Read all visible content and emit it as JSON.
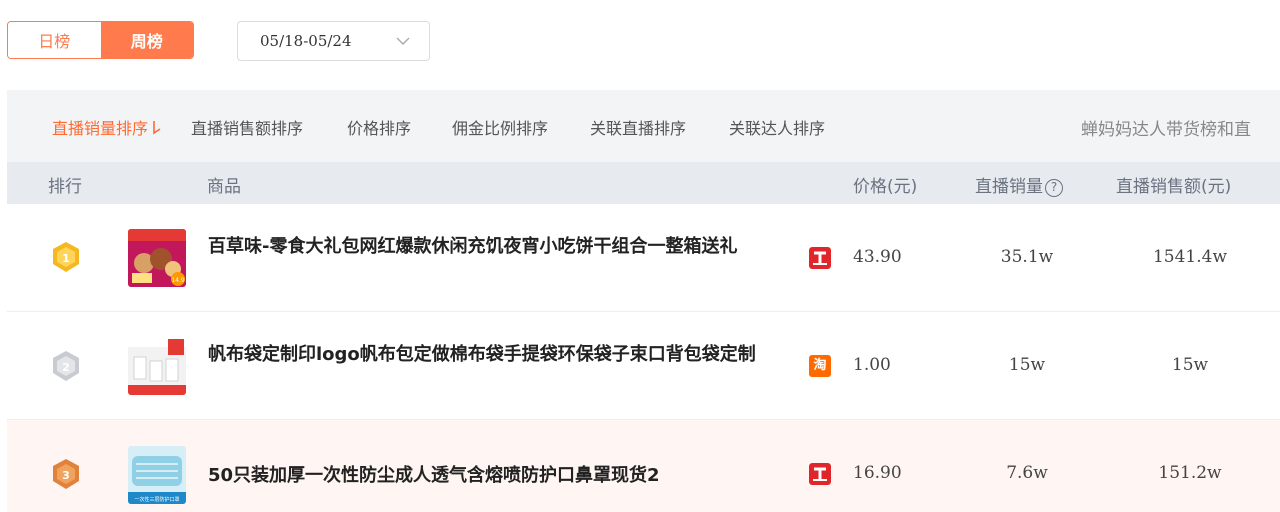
{
  "toggle": {
    "daily": "日榜",
    "weekly": "周榜"
  },
  "date_range": "05/18-05/24",
  "sort_options": [
    "直播销量排序",
    "直播销售额排序",
    "价格排序",
    "佣金比例排序",
    "关联直播排序",
    "关联达人排序"
  ],
  "right_title": "蝉妈妈达人带货榜和直",
  "columns": {
    "rank": "排行",
    "product": "商品",
    "price": "价格(元)",
    "sales": "直播销量",
    "amount": "直播销售额(元)"
  },
  "rows": [
    {
      "rank": "1",
      "name": "百草味-零食大礼包网红爆款休闲充饥夜宵小吃饼干组合一整箱送礼",
      "platform": "tmall",
      "price": "43.90",
      "sales": "35.1w",
      "amount": "1541.4w"
    },
    {
      "rank": "2",
      "name": "帆布袋定制印logo帆布包定做棉布袋手提袋环保袋子束口背包袋定制",
      "platform": "taobao",
      "price": "1.00",
      "sales": "15w",
      "amount": "15w"
    },
    {
      "rank": "3",
      "name": "50只装加厚一次性防尘成人透气含熔喷防护口鼻罩现货2",
      "platform": "tmall",
      "price": "16.90",
      "sales": "7.6w",
      "amount": "151.2w"
    }
  ],
  "platform_labels": {
    "taobao": "淘"
  },
  "thumb_texts": {
    "row1_price": "14.9",
    "row3_caption": "一次性三层防护口罩"
  },
  "colors": {
    "accent": "#ff7a4d",
    "gold": "#f5b820",
    "silver": "#c8cbd0",
    "bronze": "#e0823c",
    "tmall": "#e0262b",
    "taobao": "#ff6a00"
  }
}
